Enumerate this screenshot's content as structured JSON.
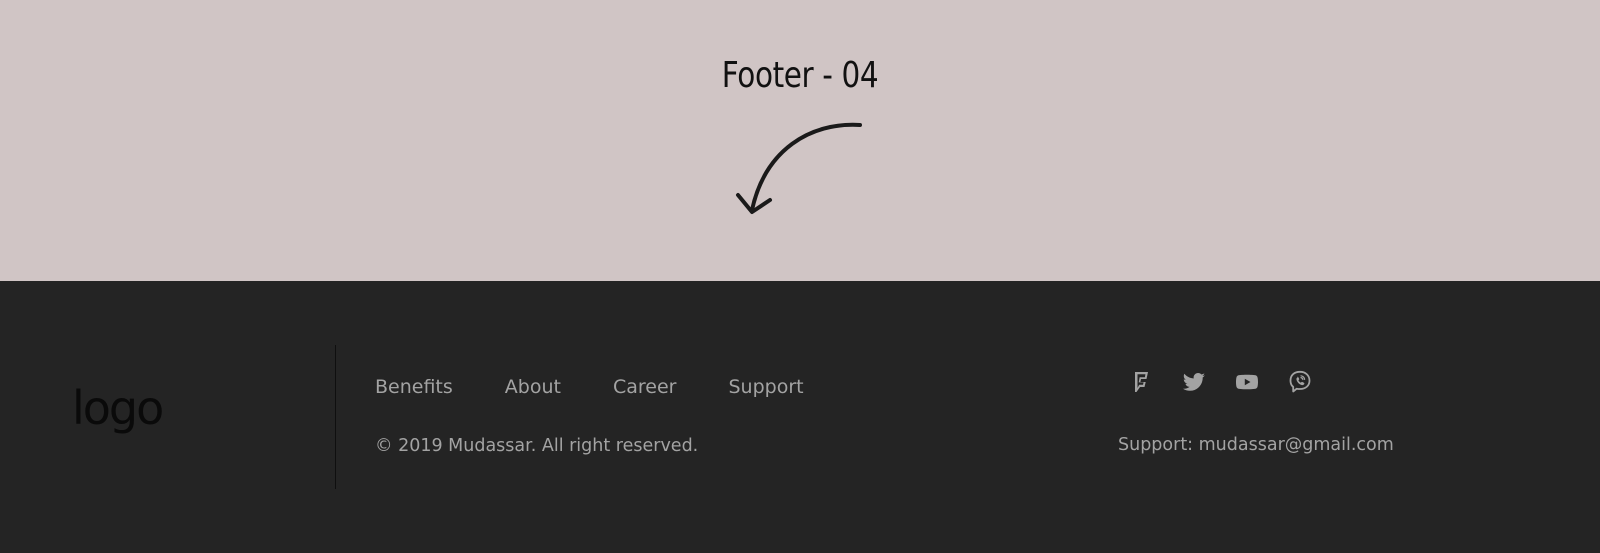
{
  "hero": {
    "title": "Footer - 04",
    "arrow_icon": "curved-arrow-down-icon"
  },
  "footer": {
    "logo_text": "logo",
    "nav": [
      {
        "label": "Benefits"
      },
      {
        "label": "About"
      },
      {
        "label": "Career"
      },
      {
        "label": "Support"
      }
    ],
    "copyright": "© 2019 Mudassar. All right reserved.",
    "social": [
      {
        "icon": "foursquare-icon"
      },
      {
        "icon": "twitter-icon"
      },
      {
        "icon": "youtube-icon"
      },
      {
        "icon": "viber-icon"
      }
    ],
    "support": "Support: mudassar@gmail.com"
  },
  "colors": {
    "hero_bg": "#d0c5c5",
    "footer_bg": "#242424",
    "text_muted": "#a3a3a3",
    "title": "#111111"
  }
}
